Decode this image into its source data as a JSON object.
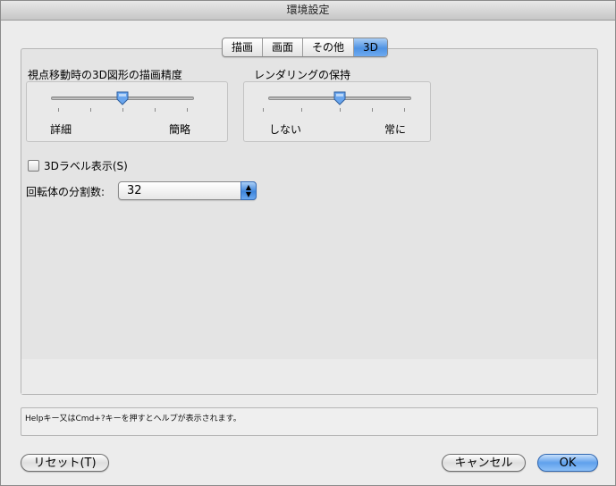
{
  "window": {
    "title": "環境設定"
  },
  "tabs": [
    {
      "label": "描画",
      "active": false
    },
    {
      "label": "画面",
      "active": false
    },
    {
      "label": "その他",
      "active": false
    },
    {
      "label": "3D",
      "active": true
    }
  ],
  "precision_group": {
    "label": "視点移動時の3D図形の描画精度",
    "min_label": "詳細",
    "max_label": "簡略",
    "value_fraction": 0.5
  },
  "render_group": {
    "label": "レンダリングの保持",
    "min_label": "しない",
    "max_label": "常に",
    "value_fraction": 0.5
  },
  "label_checkbox": {
    "label": "3Dラベル表示(S)",
    "checked": false
  },
  "segments": {
    "label": "回転体の分割数:",
    "value": "32"
  },
  "help": {
    "text": "Helpキー又はCmd+?キーを押すとヘルプが表示されます。"
  },
  "buttons": {
    "reset": "リセット(T)",
    "cancel": "キャンセル",
    "ok": "OK"
  },
  "colors": {
    "accent": "#4f93e3",
    "panel": "#e4e4e4",
    "window": "#ececec"
  }
}
